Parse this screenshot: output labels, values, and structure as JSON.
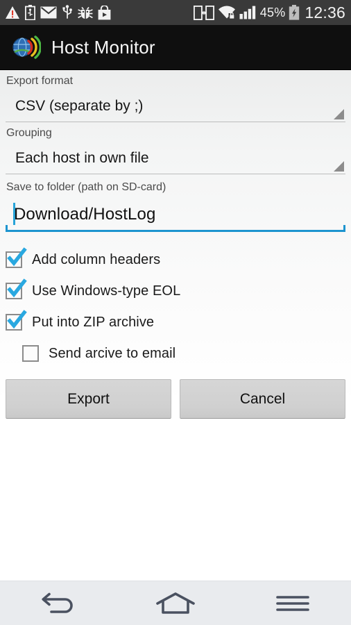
{
  "status_bar": {
    "icons_left": [
      "warning-triangle-icon",
      "usb-battery-icon",
      "email-icon",
      "usb-icon",
      "debug-bug-icon",
      "play-store-icon"
    ],
    "icons_right": [
      "screen-share-icon",
      "wifi-secured-icon",
      "signal-bars-icon",
      "charging-battery-icon"
    ],
    "battery_percent": "45%",
    "clock": "12:36"
  },
  "title_bar": {
    "app_icon": "globe-signal-icon",
    "title": "Host Monitor"
  },
  "form": {
    "export_format": {
      "label": "Export format",
      "value": "CSV (separate by ;)",
      "arrow_icon": "spinner-triangle-icon"
    },
    "grouping": {
      "label": "Grouping",
      "value": "Each host in own file",
      "arrow_icon": "spinner-triangle-icon"
    },
    "save_folder": {
      "label": "Save to folder (path on SD-card)",
      "value": "Download/HostLog",
      "placeholder": "Download/HostLog"
    },
    "checkboxes": [
      {
        "label": "Add column headers",
        "checked": true
      },
      {
        "label": "Use Windows-type EOL",
        "checked": true
      },
      {
        "label": "Put into ZIP archive",
        "checked": true
      },
      {
        "label": "Send arcive to email",
        "checked": false
      }
    ]
  },
  "actions": {
    "export_label": "Export",
    "cancel_label": "Cancel"
  },
  "nav_bar": {
    "back": "back-icon",
    "home": "home-icon",
    "menu": "menu-icon"
  },
  "colors": {
    "accent": "#1d94cf",
    "status_bar_bg": "#3a3a3a",
    "title_bar_bg": "#0f0f0f",
    "nav_bar_bg": "#e9ebee",
    "warning": "#e03a2a"
  }
}
